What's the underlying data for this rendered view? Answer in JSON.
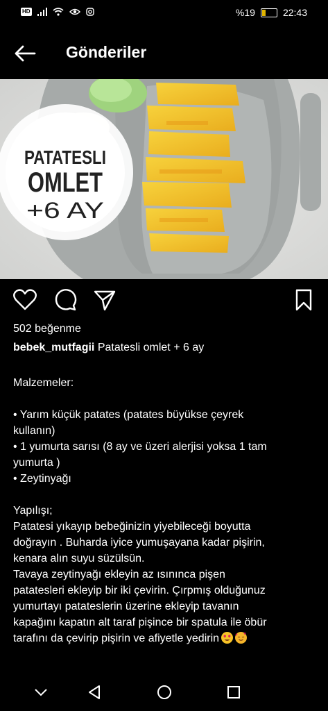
{
  "status": {
    "left_badge": "HD",
    "battery_text": "%19",
    "time": "22:43"
  },
  "appbar": {
    "title": "Gönderiler"
  },
  "photo": {
    "overlay_line1": "PATATESLI",
    "overlay_line2": "OMLET",
    "overlay_line3": "+6 AY"
  },
  "post": {
    "likes": "502 beğenme",
    "username": "bebek_mutfagii",
    "caption": "Patatesli omlet + 6 ay",
    "body_lines": [
      "Malzemeler:",
      "",
      " • Yarım küçük patates (patates büyükse çeyrek",
      "kullanın)",
      " • 1 yumurta sarısı (8 ay ve üzeri alerjisi yoksa 1 tam",
      "yumurta )",
      " • Zeytinyağı",
      "",
      "Yapılışı;",
      "Patatesi yıkayıp bebeğinizin yiyebileceği boyutta",
      "doğrayın . Buharda iyice yumuşayana kadar pişirin,",
      "kenara alın suyu süzülsün.",
      "Tavaya zeytinyağı ekleyin az ısınınca pişen",
      "patatesleri ekleyip bir iki çevirin. Çırpmış olduğunuz",
      "yumurtayı patateslerin üzerine ekleyip tavanın",
      "kapağını kapatın alt taraf pişince bir spatula ile öbür",
      "tarafını da çevirip pişirin ve afiyetle yedirin"
    ],
    "end_emojis": [
      "heart-eyes-emoji",
      "smiling-face-with-hearts-emoji"
    ]
  },
  "colors": {
    "background": "#000000",
    "text": "#ffffff",
    "omelet": "#f2c230",
    "plate": "#a7abab"
  }
}
